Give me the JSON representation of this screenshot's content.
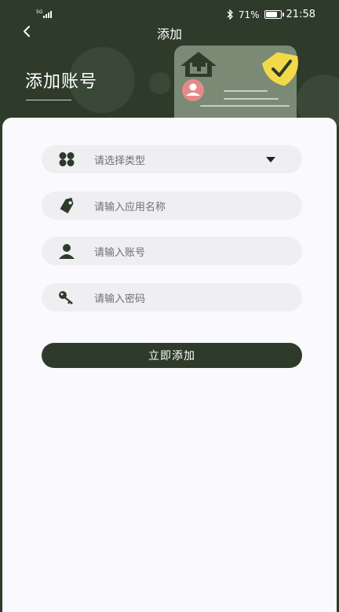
{
  "status_bar": {
    "network": "5G",
    "battery": "71%",
    "time": "21:58"
  },
  "nav": {
    "title": "添加"
  },
  "header": {
    "heading": "添加账号"
  },
  "form": {
    "type_select": {
      "placeholder": "请选择类型"
    },
    "app_name": {
      "placeholder": "请输入应用名称"
    },
    "account": {
      "placeholder": "请输入账号"
    },
    "password": {
      "placeholder": "请输入密码"
    },
    "submit_label": "立即添加"
  },
  "colors": {
    "brand_dark_green": "#2e3b2b",
    "card_background": "#faf9fd",
    "field_background": "#efeff1",
    "badge_yellow": "#f2d94a",
    "avatar_pink": "#e58a8a"
  },
  "icons": [
    "back-arrow-icon",
    "bluetooth-icon",
    "battery-icon",
    "grid-icon",
    "tag-icon",
    "user-icon",
    "key-icon",
    "dropdown-caret-icon"
  ]
}
